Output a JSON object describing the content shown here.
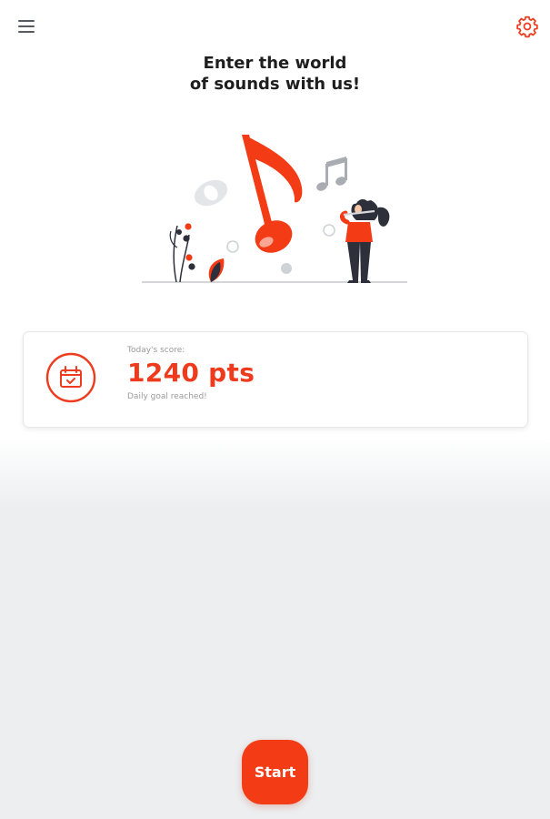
{
  "header": {
    "menu_icon": "hamburger-menu-icon",
    "settings_icon": "gear-icon"
  },
  "headline": {
    "line1": "Enter the world",
    "line2": "of sounds with us!"
  },
  "hero": {
    "illustration": "music-notes-woman-playing-flute-illustration"
  },
  "score_card": {
    "icon": "calendar-check-icon",
    "caption": "Today's score:",
    "value": "1240 pts",
    "status": "Daily goal reached!"
  },
  "start_button": {
    "label": "Start"
  },
  "colors": {
    "accent": "#f33b15",
    "score_text": "#ee3b1d",
    "icon_gray": "#555a60",
    "background_bottom": "#eceef0"
  }
}
